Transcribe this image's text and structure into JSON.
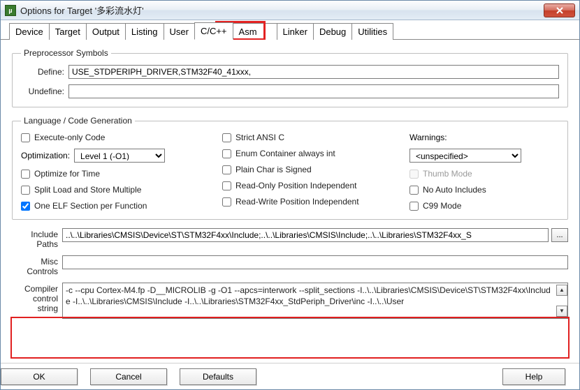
{
  "window": {
    "title": "Options for Target '多彩流水灯'"
  },
  "tabs": [
    "Device",
    "Target",
    "Output",
    "Listing",
    "User",
    "C/C++",
    "Asm",
    "Linker",
    "Debug",
    "Utilities"
  ],
  "preprocessor": {
    "legend": "Preprocessor Symbols",
    "define_label": "Define:",
    "define_value": "USE_STDPERIPH_DRIVER,STM32F40_41xxx,",
    "undefine_label": "Undefine:",
    "undefine_value": ""
  },
  "langgen": {
    "legend": "Language / Code Generation",
    "exec_only": "Execute-only Code",
    "optimization_label": "Optimization:",
    "optimization_value": "Level 1 (-O1)",
    "optimize_time": "Optimize for Time",
    "split_load": "Split Load and Store Multiple",
    "one_elf": "One ELF Section per Function",
    "strict_ansi": "Strict ANSI C",
    "enum_container": "Enum Container always int",
    "plain_char": "Plain Char is Signed",
    "ro_pi": "Read-Only Position Independent",
    "rw_pi": "Read-Write Position Independent",
    "warnings_label": "Warnings:",
    "warnings_value": "<unspecified>",
    "thumb_mode": "Thumb Mode",
    "no_auto_inc": "No Auto Includes",
    "c99": "C99 Mode"
  },
  "include": {
    "label": "Include\nPaths",
    "value": "..\\..\\Libraries\\CMSIS\\Device\\ST\\STM32F4xx\\Include;..\\..\\Libraries\\CMSIS\\Include;..\\..\\Libraries\\STM32F4xx_S"
  },
  "misc": {
    "label": "Misc\nControls",
    "value": ""
  },
  "ccs": {
    "label": "Compiler\ncontrol\nstring",
    "value": "-c --cpu Cortex-M4.fp -D__MICROLIB -g -O1 --apcs=interwork --split_sections -I..\\..\\Libraries\\CMSIS\\Device\\ST\\STM32F4xx\\Include -I..\\..\\Libraries\\CMSIS\\Include -I..\\..\\Libraries\\STM32F4xx_StdPeriph_Driver\\inc -I..\\..\\User"
  },
  "buttons": {
    "ok": "OK",
    "cancel": "Cancel",
    "defaults": "Defaults",
    "help": "Help",
    "browse": "..."
  }
}
